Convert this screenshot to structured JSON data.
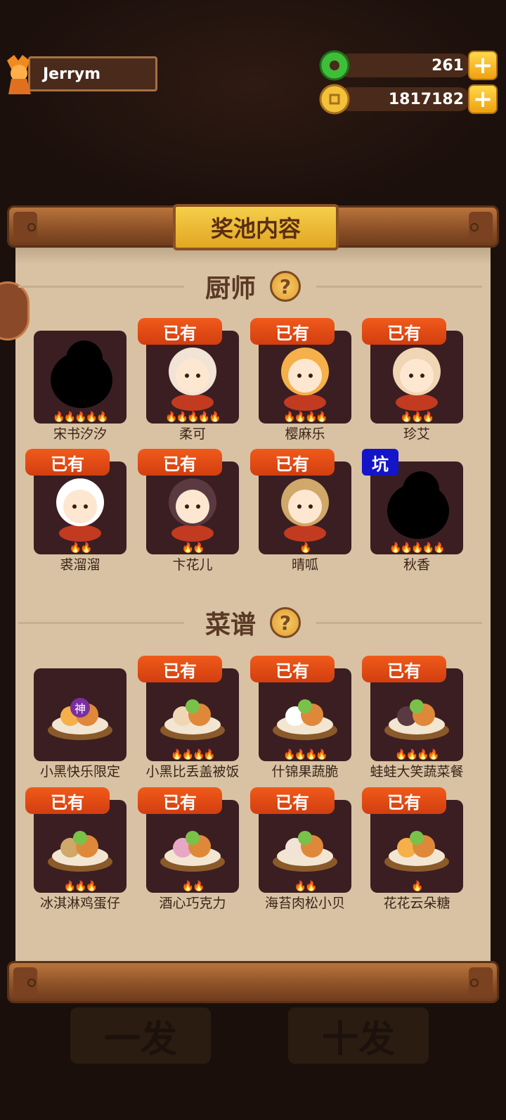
{
  "player": {
    "name": "Jerrym"
  },
  "resources": {
    "jade": "261",
    "coins": "1817182",
    "plus": "+"
  },
  "panel": {
    "title": "奖池内容"
  },
  "chef_section": {
    "title": "厨师",
    "help": "?",
    "items": [
      {
        "name": "宋书汐汐",
        "tag": "",
        "flames": "🔥🔥🔥🔥🔥",
        "silhouette": true
      },
      {
        "name": "柔可",
        "tag": "已有",
        "flames": "🔥🔥🔥🔥🔥"
      },
      {
        "name": "樱麻乐",
        "tag": "已有",
        "flames": "🔥🔥🔥🔥"
      },
      {
        "name": "珍艾",
        "tag": "已有",
        "flames": "🔥🔥🔥"
      },
      {
        "name": "裘溜溜",
        "tag": "已有",
        "flames": "🔥🔥"
      },
      {
        "name": "卞花儿",
        "tag": "已有",
        "flames": "🔥🔥"
      },
      {
        "name": "晴呱",
        "tag": "已有",
        "flames": "🔥"
      },
      {
        "name": "秋香",
        "tag": "坑",
        "flames": "🔥🔥🔥🔥🔥",
        "silhouette": true
      }
    ]
  },
  "recipe_section": {
    "title": "菜谱",
    "help": "?",
    "items": [
      {
        "name": "小黑快乐限定",
        "tag": "",
        "flames": "",
        "badge": "神"
      },
      {
        "name": "小黑比丢盖被饭",
        "tag": "已有",
        "flames": "🔥🔥🔥🔥"
      },
      {
        "name": "什锦果蔬脆",
        "tag": "已有",
        "flames": "🔥🔥🔥🔥"
      },
      {
        "name": "蛙蛙大笑蔬菜餐",
        "tag": "已有",
        "flames": "🔥🔥🔥🔥"
      },
      {
        "name": "冰淇淋鸡蛋仔",
        "tag": "已有",
        "flames": "🔥🔥🔥"
      },
      {
        "name": "酒心巧克力",
        "tag": "已有",
        "flames": "🔥🔥"
      },
      {
        "name": "海苔肉松小贝",
        "tag": "已有",
        "flames": "🔥🔥"
      },
      {
        "name": "花花云朵糖",
        "tag": "已有",
        "flames": "🔥"
      }
    ]
  },
  "bottom_buttons": {
    "single": "一发",
    "ten": "十发"
  }
}
